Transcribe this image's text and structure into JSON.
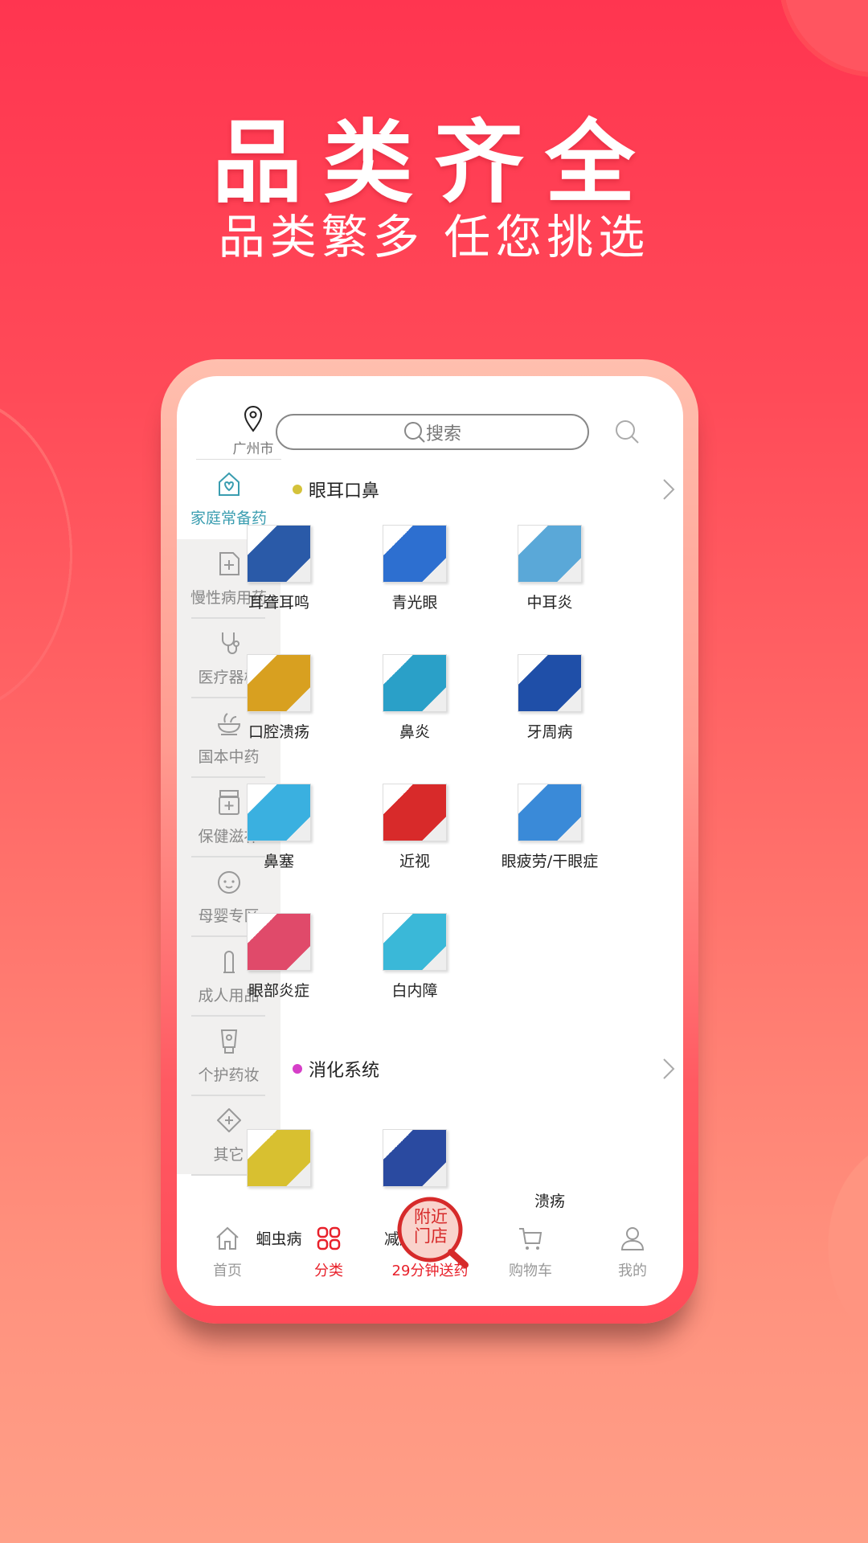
{
  "hero": {
    "title": "品类齐全",
    "subtitle": "品类繁多 任您挑选"
  },
  "header": {
    "location": "广州市",
    "search_placeholder": "搜索"
  },
  "sidebar": {
    "items": [
      {
        "label": "家庭常备药",
        "icon": "house-heart-icon",
        "active": true
      },
      {
        "label": "慢性病用药",
        "icon": "document-plus-icon"
      },
      {
        "label": "医疗器械",
        "icon": "stethoscope-icon"
      },
      {
        "label": "国本中药",
        "icon": "herb-bowl-icon"
      },
      {
        "label": "保健滋补",
        "icon": "supplement-jar-icon"
      },
      {
        "label": "母婴专区",
        "icon": "baby-face-icon"
      },
      {
        "label": "成人用品",
        "icon": "condom-icon"
      },
      {
        "label": "个护药妆",
        "icon": "cosmetic-tube-icon"
      },
      {
        "label": "其它",
        "icon": "diamond-plus-icon"
      }
    ]
  },
  "sections": [
    {
      "title": "眼耳口鼻",
      "dot_color": "#d4c23a",
      "products": [
        {
          "label": "耳聋耳鸣",
          "color": "#2a5aa8"
        },
        {
          "label": "青光眼",
          "color": "#2d6fd0"
        },
        {
          "label": "中耳炎",
          "color": "#5aa8d8"
        },
        {
          "label": "口腔溃疡",
          "color": "#d8a020"
        },
        {
          "label": "鼻炎",
          "color": "#2aa0c8"
        },
        {
          "label": "牙周病",
          "color": "#1f4fa8"
        },
        {
          "label": "鼻塞",
          "color": "#3ab0e0"
        },
        {
          "label": "近视",
          "color": "#d82a2a"
        },
        {
          "label": "眼疲劳/干眼症",
          "color": "#3a8ad8"
        },
        {
          "label": "眼部炎症",
          "color": "#e04a6a"
        },
        {
          "label": "白内障",
          "color": "#3ab8d8"
        }
      ]
    },
    {
      "title": "消化系统",
      "dot_color": "#d63fc8",
      "products": [
        {
          "label": "蛔虫病",
          "color": "#d8c030"
        },
        {
          "label": "减肥瘦身",
          "color": "#2a4aa0"
        },
        {
          "label": "溃疡",
          "color": ""
        }
      ]
    }
  ],
  "nearby_store": {
    "label": "附近门店"
  },
  "nav": {
    "items": [
      {
        "label": "首页",
        "icon": "home-icon"
      },
      {
        "label": "分类",
        "icon": "category-grid-icon",
        "active": true
      },
      {
        "label": "29分钟送药",
        "icon": "",
        "active": true
      },
      {
        "label": "购物车",
        "icon": "cart-icon"
      },
      {
        "label": "我的",
        "icon": "user-icon"
      }
    ]
  },
  "colors": {
    "accent": "#e8202a",
    "sidebar_active": "#3a9db0",
    "background_top": "#ff3550",
    "background_bottom": "#ffa088"
  }
}
